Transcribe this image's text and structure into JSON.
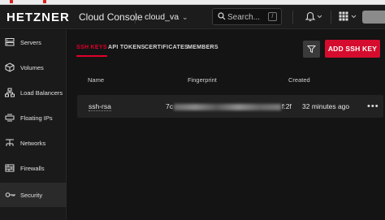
{
  "header": {
    "logo": "HETZNER",
    "product": "Cloud Console",
    "project": "cloud_va",
    "search_placeholder": "Search...",
    "search_shortcut": "/"
  },
  "sidebar": {
    "items": [
      {
        "label": "Servers",
        "icon": "server-icon"
      },
      {
        "label": "Volumes",
        "icon": "volume-icon"
      },
      {
        "label": "Load Balancers",
        "icon": "load-balancer-icon"
      },
      {
        "label": "Floating IPs",
        "icon": "floating-ip-icon"
      },
      {
        "label": "Networks",
        "icon": "network-icon"
      },
      {
        "label": "Firewalls",
        "icon": "firewall-icon"
      },
      {
        "label": "Security",
        "icon": "key-icon",
        "active": true
      }
    ]
  },
  "main": {
    "tabs": [
      {
        "label": "SSH KEYS",
        "active": true
      },
      {
        "label": "API TOKENS"
      },
      {
        "label": "CERTIFICATES"
      },
      {
        "label": "MEMBERS"
      }
    ],
    "add_button": "ADD SSH KEY",
    "columns": [
      "Name",
      "Fingerprint",
      "Created"
    ],
    "rows": [
      {
        "name": "ssh-rsa",
        "fingerprint_start": "7c",
        "fingerprint_end": "f:2f",
        "created": "32 minutes ago",
        "more": "•••"
      }
    ]
  },
  "colors": {
    "accent": "#d50c2d",
    "background": "#141414",
    "sidebar": "#1a1a1a"
  }
}
